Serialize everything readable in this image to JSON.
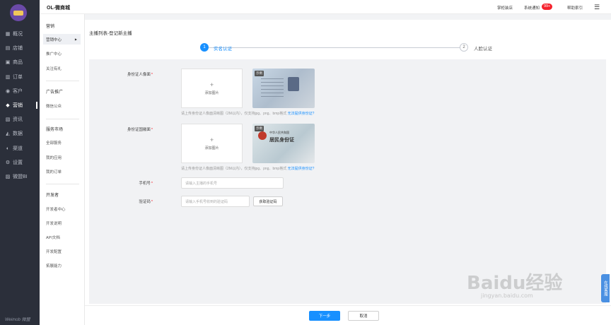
{
  "app": {
    "title": "OL-微商城"
  },
  "topbar": {
    "links": [
      "掌柜装店",
      "系统通知",
      "帮助索引"
    ],
    "notice_badge": "99+"
  },
  "sidebar": {
    "items": [
      {
        "label": "概况",
        "icon": "grid-icon"
      },
      {
        "label": "店铺",
        "icon": "store-icon"
      },
      {
        "label": "商品",
        "icon": "goods-icon"
      },
      {
        "label": "订单",
        "icon": "order-icon"
      },
      {
        "label": "客户",
        "icon": "user-icon"
      },
      {
        "label": "营销",
        "icon": "marketing-icon"
      },
      {
        "label": "资讯",
        "icon": "news-icon"
      },
      {
        "label": "数据",
        "icon": "chart-icon"
      },
      {
        "label": "渠道",
        "icon": "channel-icon"
      },
      {
        "label": "设置",
        "icon": "gear-icon"
      },
      {
        "label": "微盟BI",
        "icon": "bi-icon"
      }
    ],
    "brand": "Weimob 微盟"
  },
  "nav2": {
    "sections": [
      {
        "title": "营销",
        "items": [
          "营销中心",
          "推广中心",
          "关注有礼"
        ]
      },
      {
        "title": "广告推广",
        "items": [
          "微信公众"
        ]
      },
      {
        "title": "服务市场",
        "items": [
          "全部服务",
          "我的应用",
          "我的订单"
        ]
      },
      {
        "title": "开发者",
        "items": [
          "开发者中心",
          "开发说明",
          "API文档",
          "开发配置",
          "拓展能力"
        ]
      }
    ]
  },
  "main": {
    "breadcrumb": "主播列表-登记新主播",
    "steps": [
      {
        "num": "1",
        "label": "实名认证"
      },
      {
        "num": "2",
        "label": "人脸认证"
      }
    ],
    "form": {
      "id_front_label": "身份证人像面",
      "id_back_label": "身份证国徽面",
      "add_image": "添加图片",
      "example_tag": "示例",
      "id_card_title": "中华人民共和国",
      "id_card_big": "居民身份证",
      "hint_text": "请上传身份证人像面清晰图（2M以内），仅支持jpg、png、bmp格式",
      "hint_back_text": "请上传身份证人像面清晰图（2M以内），仅支持jpg、png、bmp格式",
      "hint_link": "无法提供身份证?",
      "phone_label": "手机号",
      "phone_placeholder": "请输入主播的手机号",
      "code_label": "验证码",
      "code_placeholder": "请输入手机号收到的验证码",
      "get_code_button": "获取验证码"
    }
  },
  "footer": {
    "next": "下一步",
    "cancel": "取消"
  },
  "float_tab": "在线客服",
  "watermark": {
    "main": "Baidu经验",
    "sub": "jingyan.baidu.com"
  },
  "colors": {
    "primary": "#1890ff",
    "sidebar_bg": "#2b2f3a",
    "badge": "#f5222d"
  }
}
